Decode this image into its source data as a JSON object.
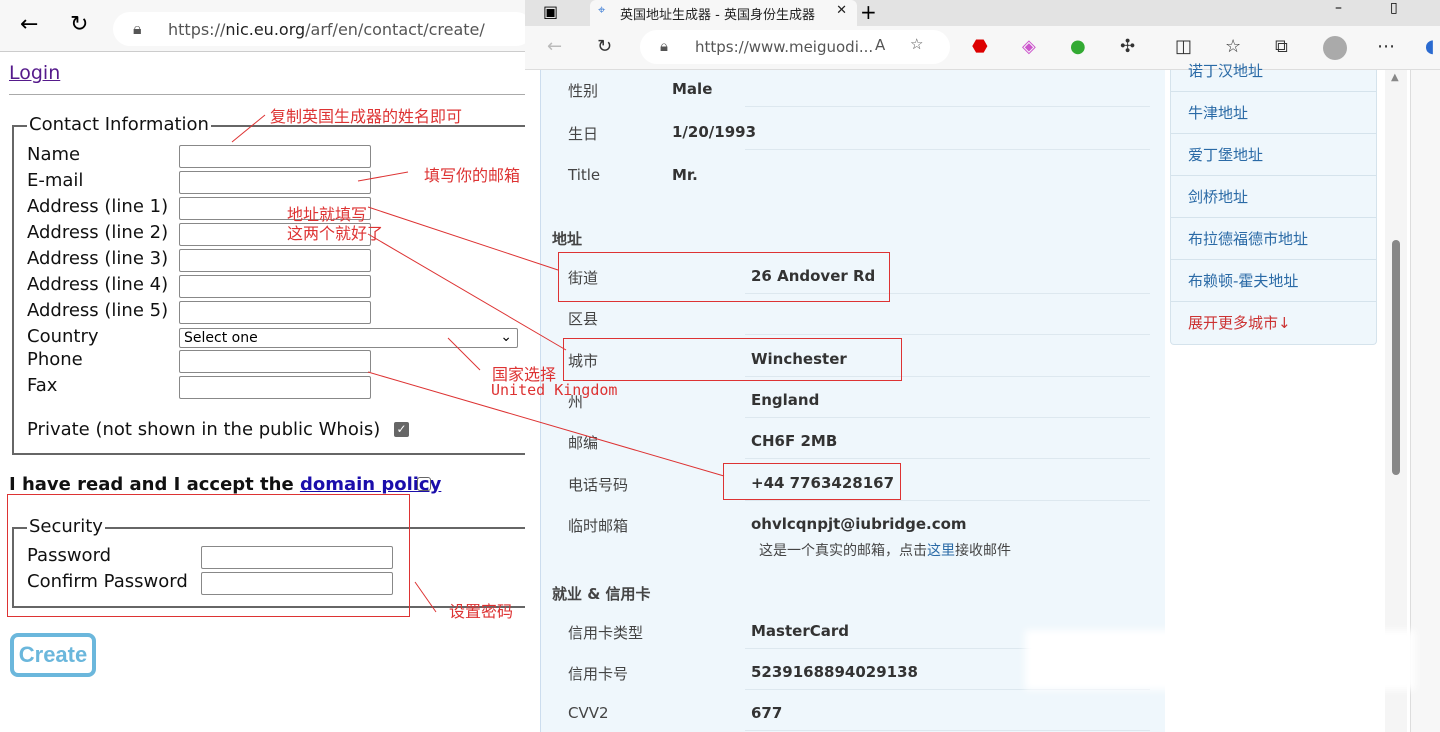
{
  "left_window": {
    "url_prefix": "https://",
    "url_host": "nic.eu.org",
    "url_path": "/arf/en/contact/create/",
    "login_link": "Login",
    "contact": {
      "legend": "Contact Information",
      "fields": [
        {
          "label": "Name",
          "value": ""
        },
        {
          "label": "E-mail",
          "value": ""
        },
        {
          "label": "Address (line 1)",
          "value": ""
        },
        {
          "label": "Address (line 2)",
          "value": ""
        },
        {
          "label": "Address (line 3)",
          "value": ""
        },
        {
          "label": "Address (line 4)",
          "value": ""
        },
        {
          "label": "Address (line 5)",
          "value": ""
        }
      ],
      "country_label": "Country",
      "country_value": "Select one",
      "phone_label": "Phone",
      "fax_label": "Fax",
      "private_label": "Private (not shown in the public Whois)",
      "private_checked": true
    },
    "policy_text": "I have read and I accept the ",
    "policy_link": "domain policy",
    "policy_checked": false,
    "security": {
      "legend": "Security",
      "password_label": "Password",
      "confirm_label": "Confirm Password"
    },
    "create_button": "Create"
  },
  "annotations": {
    "name": "复制英国生成器的姓名即可",
    "email": "填写你的邮箱",
    "address_1": "地址就填写",
    "address_2": "这两个就好了",
    "country_1": "国家选择",
    "country_2": "United Kingdom",
    "password": "设置密码",
    "color": "#dd3333"
  },
  "right_window": {
    "tab_title": "英国地址生成器 - 英国身份生成器",
    "url": "https://www.meiguodi...",
    "rows_top": [
      {
        "label": "性别",
        "value": "Male"
      },
      {
        "label": "生日",
        "value": "1/20/1993"
      },
      {
        "label": "Title",
        "value": "Mr."
      }
    ],
    "address_heading": "地址",
    "address_rows": [
      {
        "label": "街道",
        "value": "26 Andover Rd"
      },
      {
        "label": "区县",
        "value": ""
      },
      {
        "label": "城市",
        "value": "Winchester"
      },
      {
        "label": "州",
        "value": "England"
      },
      {
        "label": "邮编",
        "value": "CH6F 2MB"
      },
      {
        "label": "电话号码",
        "value": "+44 7763428167"
      },
      {
        "label": "临时邮箱",
        "value": "ohvlcqnpjt@iubridge.com"
      }
    ],
    "email_note_before": "这是一个真实的邮箱，点击",
    "email_note_link": "这里",
    "email_note_after": "接收邮件",
    "card_heading": "就业 & 信用卡",
    "card_rows": [
      {
        "label": "信用卡类型",
        "value": "MasterCard"
      },
      {
        "label": "信用卡号",
        "value": "5239168894029138"
      },
      {
        "label": "CVV2",
        "value": "677"
      }
    ],
    "sidebar": [
      "诺丁汉地址",
      "牛津地址",
      "爱丁堡地址",
      "剑桥地址",
      "布拉德福德市地址",
      "布赖顿-霍夫地址"
    ],
    "sidebar_more": "展开更多城市↓"
  }
}
